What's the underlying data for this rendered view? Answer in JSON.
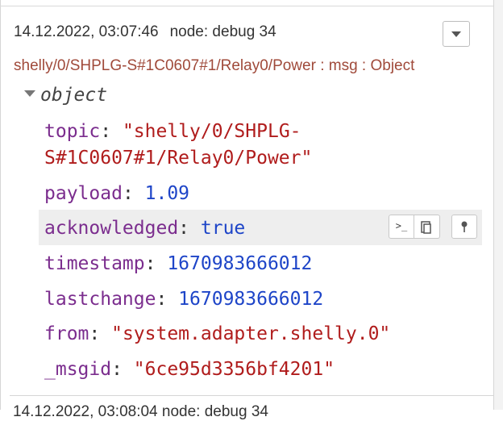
{
  "message": {
    "timestamp": "14.12.2022, 03:07:46",
    "node": "node: debug 34",
    "topic_line": "shelly/0/SHPLG-S#1C0607#1/Relay0/Power : msg : Object",
    "object_label": "object",
    "props": [
      {
        "key": "topic",
        "value_line1": "\"shelly/0/SHPLG-",
        "value_line2": "S#1C0607#1/Relay0/Power\"",
        "type": "string"
      },
      {
        "key": "payload",
        "value": "1.09",
        "type": "number"
      },
      {
        "key": "acknowledged",
        "value": "true",
        "type": "boolean"
      },
      {
        "key": "timestamp",
        "value": "1670983666012",
        "type": "number"
      },
      {
        "key": "lastchange",
        "value": "1670983666012",
        "type": "number"
      },
      {
        "key": "from",
        "value": "\"system.adapter.shelly.0\"",
        "type": "string"
      },
      {
        "key": "_msgid",
        "value": "\"6ce95d3356bf4201\"",
        "type": "string"
      }
    ],
    "tools": {
      "copy_path_icon": ">_",
      "copy_value_icon": "clipboard-icon",
      "pin_icon": "pin-icon"
    }
  },
  "next_message": {
    "partial_meta": "14.12.2022, 03:08:04    node: debug 34"
  },
  "colors": {
    "key": "#7b2d8e",
    "string": "#b01c1c",
    "number": "#1e45c8",
    "topic": "#a04a3a",
    "highlight": "#eeeeee"
  }
}
